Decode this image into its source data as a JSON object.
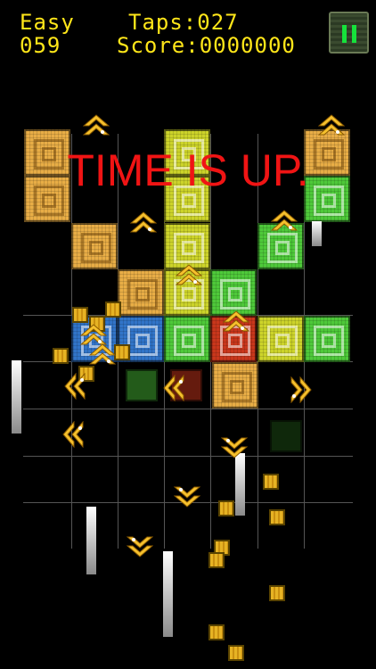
{
  "hud": {
    "difficulty": "Easy",
    "timer": "059",
    "taps": "Taps:027",
    "score": "Score:0000000"
  },
  "message": "TIME IS UP.",
  "colors": {
    "hud_text": "#ffe619",
    "message": "#f01414",
    "grid_line": "#555555",
    "orange": "#e8ad46",
    "yellow": "#ccd32a",
    "green": "#4ec93a",
    "blue": "#3174c8",
    "red": "#c9371c",
    "gold_chevron": "#f5c02d"
  },
  "icons": {
    "pause": "pause-icon",
    "falling_piece": "chevron-icon",
    "fragment": "mini-block-icon"
  }
}
